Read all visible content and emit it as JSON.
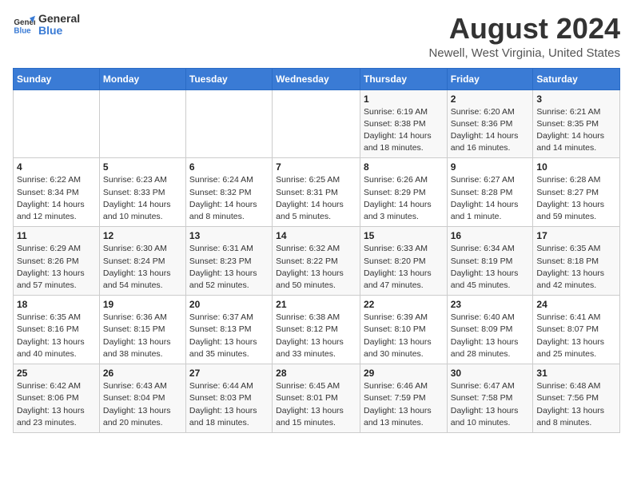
{
  "logo": {
    "line1": "General",
    "line2": "Blue"
  },
  "title": "August 2024",
  "location": "Newell, West Virginia, United States",
  "days_header": [
    "Sunday",
    "Monday",
    "Tuesday",
    "Wednesday",
    "Thursday",
    "Friday",
    "Saturday"
  ],
  "weeks": [
    [
      {
        "day": "",
        "info": ""
      },
      {
        "day": "",
        "info": ""
      },
      {
        "day": "",
        "info": ""
      },
      {
        "day": "",
        "info": ""
      },
      {
        "day": "1",
        "info": "Sunrise: 6:19 AM\nSunset: 8:38 PM\nDaylight: 14 hours\nand 18 minutes."
      },
      {
        "day": "2",
        "info": "Sunrise: 6:20 AM\nSunset: 8:36 PM\nDaylight: 14 hours\nand 16 minutes."
      },
      {
        "day": "3",
        "info": "Sunrise: 6:21 AM\nSunset: 8:35 PM\nDaylight: 14 hours\nand 14 minutes."
      }
    ],
    [
      {
        "day": "4",
        "info": "Sunrise: 6:22 AM\nSunset: 8:34 PM\nDaylight: 14 hours\nand 12 minutes."
      },
      {
        "day": "5",
        "info": "Sunrise: 6:23 AM\nSunset: 8:33 PM\nDaylight: 14 hours\nand 10 minutes."
      },
      {
        "day": "6",
        "info": "Sunrise: 6:24 AM\nSunset: 8:32 PM\nDaylight: 14 hours\nand 8 minutes."
      },
      {
        "day": "7",
        "info": "Sunrise: 6:25 AM\nSunset: 8:31 PM\nDaylight: 14 hours\nand 5 minutes."
      },
      {
        "day": "8",
        "info": "Sunrise: 6:26 AM\nSunset: 8:29 PM\nDaylight: 14 hours\nand 3 minutes."
      },
      {
        "day": "9",
        "info": "Sunrise: 6:27 AM\nSunset: 8:28 PM\nDaylight: 14 hours\nand 1 minute."
      },
      {
        "day": "10",
        "info": "Sunrise: 6:28 AM\nSunset: 8:27 PM\nDaylight: 13 hours\nand 59 minutes."
      }
    ],
    [
      {
        "day": "11",
        "info": "Sunrise: 6:29 AM\nSunset: 8:26 PM\nDaylight: 13 hours\nand 57 minutes."
      },
      {
        "day": "12",
        "info": "Sunrise: 6:30 AM\nSunset: 8:24 PM\nDaylight: 13 hours\nand 54 minutes."
      },
      {
        "day": "13",
        "info": "Sunrise: 6:31 AM\nSunset: 8:23 PM\nDaylight: 13 hours\nand 52 minutes."
      },
      {
        "day": "14",
        "info": "Sunrise: 6:32 AM\nSunset: 8:22 PM\nDaylight: 13 hours\nand 50 minutes."
      },
      {
        "day": "15",
        "info": "Sunrise: 6:33 AM\nSunset: 8:20 PM\nDaylight: 13 hours\nand 47 minutes."
      },
      {
        "day": "16",
        "info": "Sunrise: 6:34 AM\nSunset: 8:19 PM\nDaylight: 13 hours\nand 45 minutes."
      },
      {
        "day": "17",
        "info": "Sunrise: 6:35 AM\nSunset: 8:18 PM\nDaylight: 13 hours\nand 42 minutes."
      }
    ],
    [
      {
        "day": "18",
        "info": "Sunrise: 6:35 AM\nSunset: 8:16 PM\nDaylight: 13 hours\nand 40 minutes."
      },
      {
        "day": "19",
        "info": "Sunrise: 6:36 AM\nSunset: 8:15 PM\nDaylight: 13 hours\nand 38 minutes."
      },
      {
        "day": "20",
        "info": "Sunrise: 6:37 AM\nSunset: 8:13 PM\nDaylight: 13 hours\nand 35 minutes."
      },
      {
        "day": "21",
        "info": "Sunrise: 6:38 AM\nSunset: 8:12 PM\nDaylight: 13 hours\nand 33 minutes."
      },
      {
        "day": "22",
        "info": "Sunrise: 6:39 AM\nSunset: 8:10 PM\nDaylight: 13 hours\nand 30 minutes."
      },
      {
        "day": "23",
        "info": "Sunrise: 6:40 AM\nSunset: 8:09 PM\nDaylight: 13 hours\nand 28 minutes."
      },
      {
        "day": "24",
        "info": "Sunrise: 6:41 AM\nSunset: 8:07 PM\nDaylight: 13 hours\nand 25 minutes."
      }
    ],
    [
      {
        "day": "25",
        "info": "Sunrise: 6:42 AM\nSunset: 8:06 PM\nDaylight: 13 hours\nand 23 minutes."
      },
      {
        "day": "26",
        "info": "Sunrise: 6:43 AM\nSunset: 8:04 PM\nDaylight: 13 hours\nand 20 minutes."
      },
      {
        "day": "27",
        "info": "Sunrise: 6:44 AM\nSunset: 8:03 PM\nDaylight: 13 hours\nand 18 minutes."
      },
      {
        "day": "28",
        "info": "Sunrise: 6:45 AM\nSunset: 8:01 PM\nDaylight: 13 hours\nand 15 minutes."
      },
      {
        "day": "29",
        "info": "Sunrise: 6:46 AM\nSunset: 7:59 PM\nDaylight: 13 hours\nand 13 minutes."
      },
      {
        "day": "30",
        "info": "Sunrise: 6:47 AM\nSunset: 7:58 PM\nDaylight: 13 hours\nand 10 minutes."
      },
      {
        "day": "31",
        "info": "Sunrise: 6:48 AM\nSunset: 7:56 PM\nDaylight: 13 hours\nand 8 minutes."
      }
    ]
  ]
}
